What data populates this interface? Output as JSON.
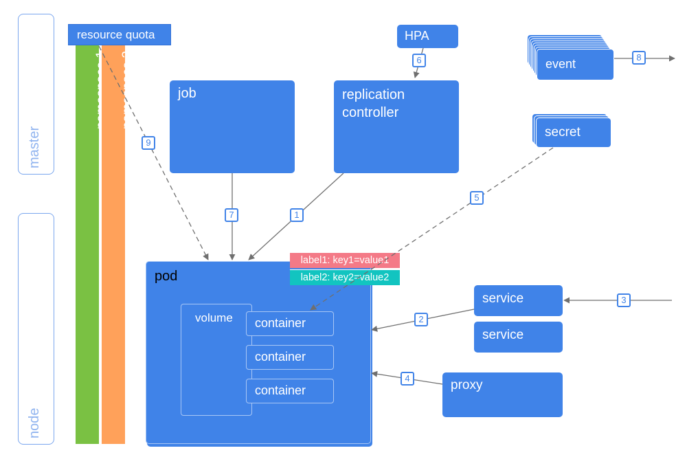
{
  "tiers": {
    "master": "master",
    "node": "node"
  },
  "namespaces": [
    {
      "label": "namespace 1",
      "color": "#7ac143"
    },
    {
      "label": "namespace 2",
      "color": "#ffa15a"
    }
  ],
  "boxes": {
    "resource_quota": "resource quota",
    "hpa": "HPA",
    "job": "job",
    "replication_controller_line1": "replication",
    "replication_controller_line2": "controller",
    "event": "event",
    "secret": "secret",
    "pod": "pod",
    "volume": "volume",
    "containers": [
      "container",
      "container",
      "container"
    ],
    "service_1": "service",
    "service_2": "service",
    "proxy": "proxy"
  },
  "labels": [
    {
      "text": "label1: key1=value1",
      "color": "#f47a87"
    },
    {
      "text": "label2: key2=value2",
      "color": "#12c4c0"
    }
  ],
  "edges": [
    {
      "id": "1",
      "from": "replication controller",
      "to": "pod",
      "style": "solid"
    },
    {
      "id": "2",
      "from": "service",
      "to": "pod",
      "style": "solid"
    },
    {
      "id": "3",
      "from": "external",
      "to": "service",
      "style": "solid"
    },
    {
      "id": "4",
      "from": "proxy",
      "to": "pod",
      "style": "solid"
    },
    {
      "id": "5",
      "from": "secret",
      "to": "container",
      "style": "dashed"
    },
    {
      "id": "6",
      "from": "HPA",
      "to": "replication controller",
      "style": "solid"
    },
    {
      "id": "7",
      "from": "job",
      "to": "pod",
      "style": "solid"
    },
    {
      "id": "8",
      "from": "event",
      "to": "external",
      "style": "solid"
    },
    {
      "id": "9",
      "from": "resource quota",
      "to": "pod",
      "style": "dashed"
    }
  ],
  "colors": {
    "primary": "#4083e8",
    "tier_border": "#7aa6ee",
    "edge": "#6f6f6f"
  }
}
